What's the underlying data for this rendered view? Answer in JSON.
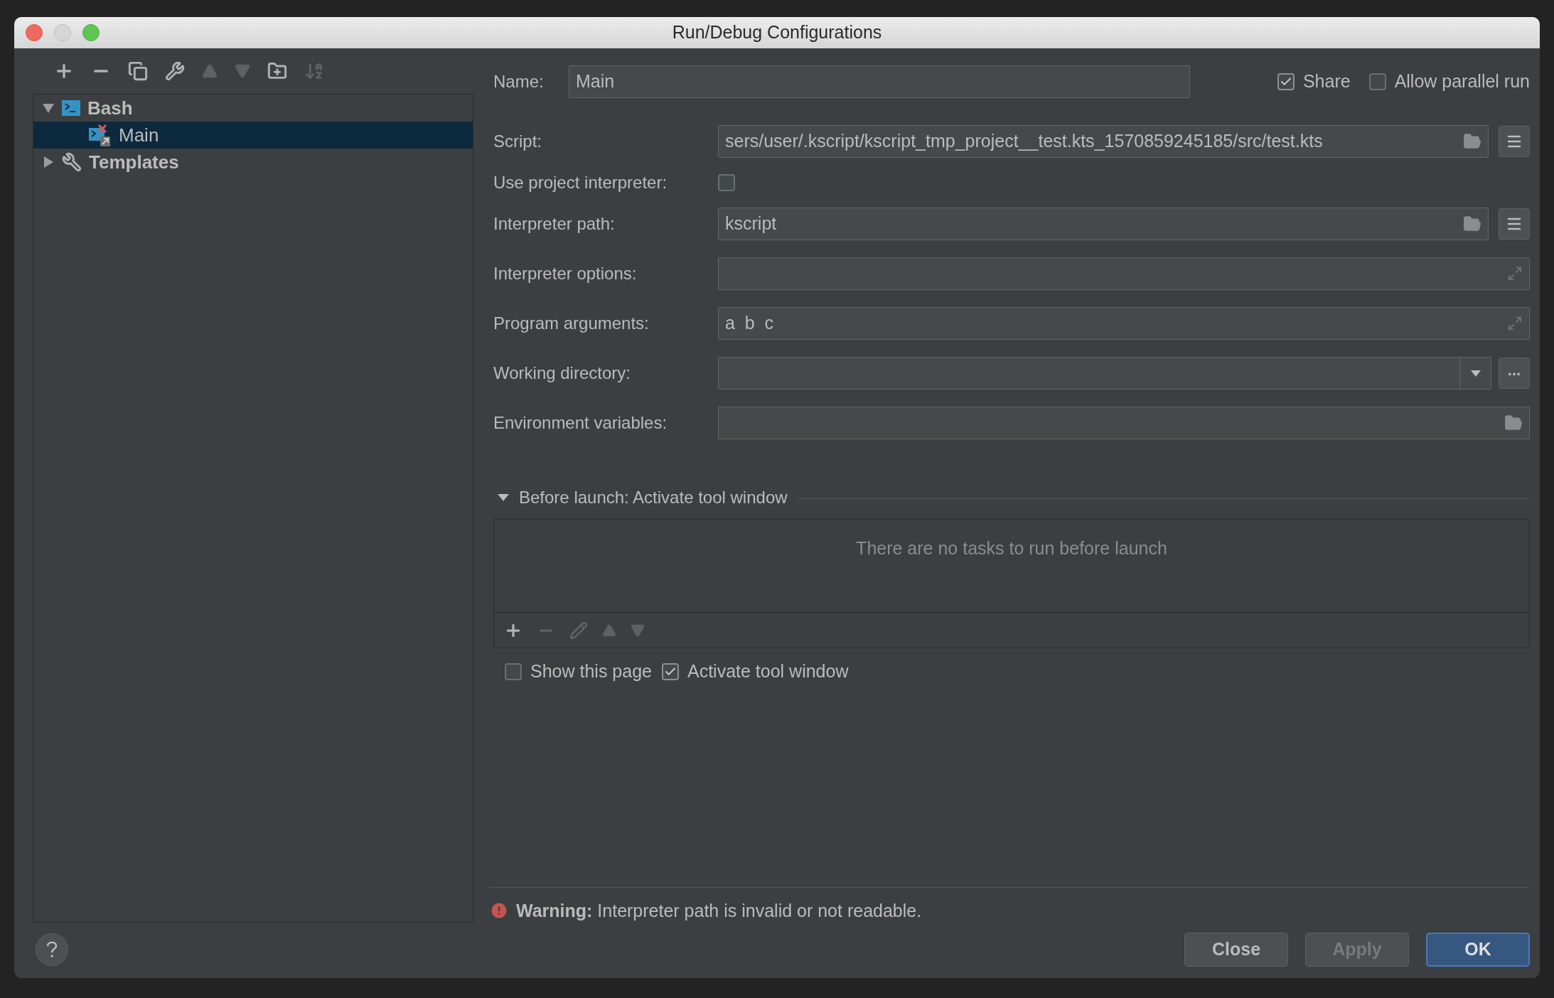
{
  "window": {
    "title": "Run/Debug Configurations"
  },
  "toolbar": [
    {
      "kind": "add",
      "disabled": false
    },
    {
      "kind": "remove",
      "disabled": false
    },
    {
      "kind": "copy",
      "disabled": false
    },
    {
      "kind": "edit",
      "disabled": false
    },
    {
      "kind": "up",
      "disabled": true
    },
    {
      "kind": "down",
      "disabled": true
    },
    {
      "kind": "folder",
      "disabled": false
    },
    {
      "kind": "sort",
      "disabled": true
    }
  ],
  "tree": [
    {
      "label": "Bash",
      "kind": "bash",
      "expanded": true,
      "selected": false,
      "children": [
        {
          "label": "Main",
          "kind": "config",
          "selected": true,
          "error": true
        }
      ]
    },
    {
      "label": "Templates",
      "kind": "templates",
      "expanded": false,
      "selected": false
    }
  ],
  "name": {
    "label": "Name:",
    "value": "Main"
  },
  "top_options": [
    {
      "label": "Share",
      "checked": true
    },
    {
      "label": "Allow parallel run",
      "checked": false
    }
  ],
  "fields": [
    {
      "kind": "browse",
      "label": "Script:",
      "value": "sers/user/.kscript/kscript_tmp_project__test.kts_1570859245185/src/test.kts"
    },
    {
      "kind": "checkbox",
      "label": "Use project interpreter:",
      "checked": false
    },
    {
      "kind": "browse",
      "label": "Interpreter path:",
      "value": "kscript"
    },
    {
      "kind": "expand",
      "label": "Interpreter options:"
    },
    {
      "kind": "expand",
      "label": "Program arguments:",
      "value": "a  b  c"
    },
    {
      "kind": "dropdown",
      "label": "Working directory:",
      "button": "..."
    },
    {
      "kind": "env",
      "label": "Environment variables:"
    }
  ],
  "before_launch": {
    "title": "Before launch: Activate tool window",
    "expanded": true,
    "empty_text": "There are no tasks to run before launch",
    "tools": [
      {
        "kind": "add",
        "disabled": false
      },
      {
        "kind": "remove",
        "disabled": true
      },
      {
        "kind": "edit",
        "disabled": true
      },
      {
        "kind": "up",
        "disabled": true
      },
      {
        "kind": "down",
        "disabled": true
      }
    ]
  },
  "launch_options": [
    {
      "label": "Show this page",
      "checked": false
    },
    {
      "label": "Activate tool window",
      "checked": true
    }
  ],
  "warning": "**Warning:** Interpreter path is invalid or not readable.",
  "buttons": [
    {
      "label": "Close",
      "default": false,
      "disabled": false
    },
    {
      "label": "Apply",
      "default": false,
      "disabled": true
    },
    {
      "label": "OK",
      "default": true,
      "disabled": false
    }
  ]
}
